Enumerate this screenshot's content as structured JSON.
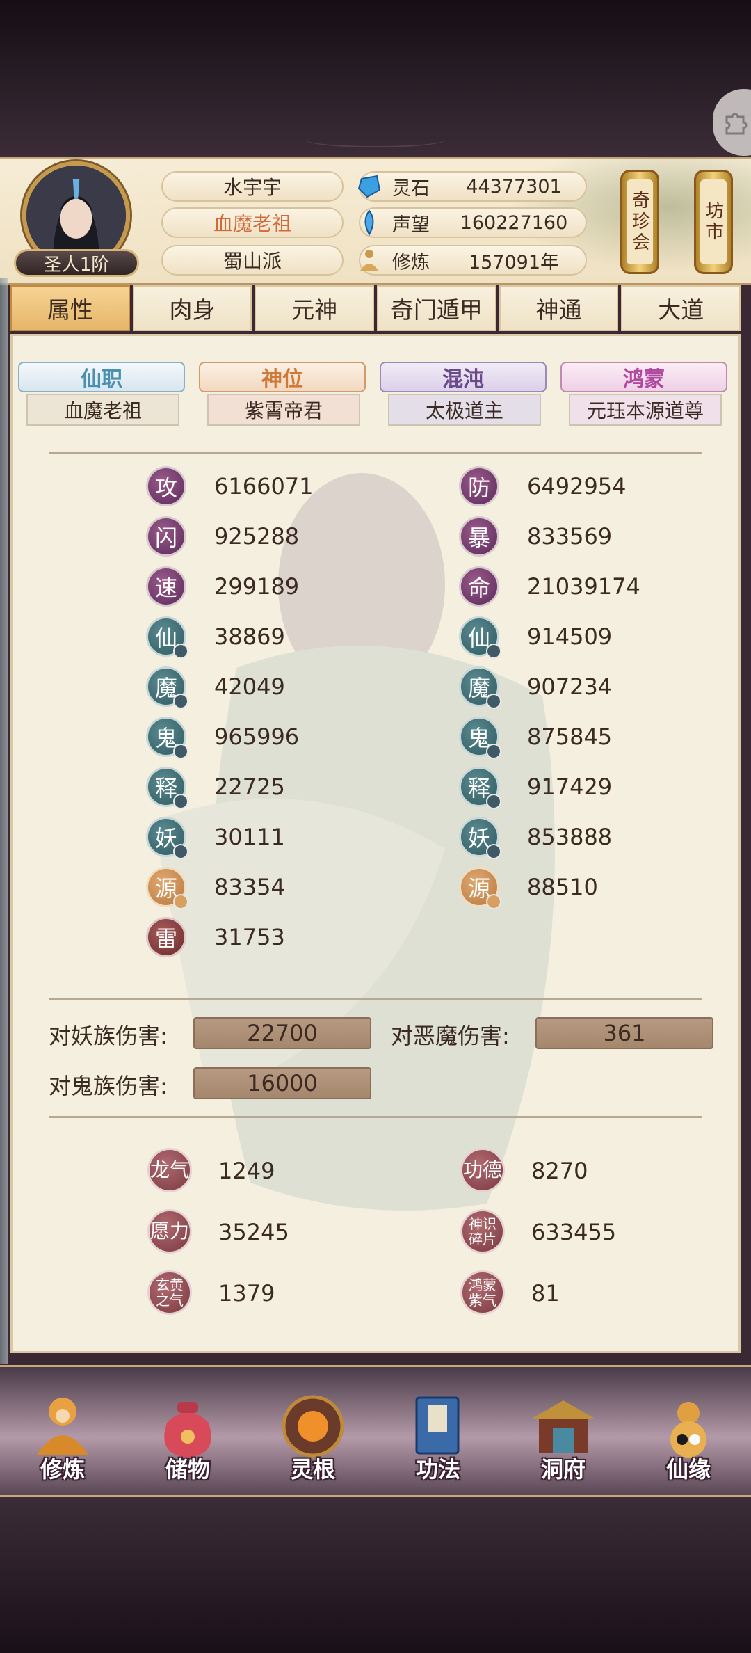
{
  "player": {
    "name": "水宇宇",
    "title": "血魔老祖",
    "sect": "蜀山派",
    "rank": "圣人1阶"
  },
  "resources": [
    {
      "label": "灵石",
      "value": "44377301",
      "icon": "spirit-stone-icon"
    },
    {
      "label": "声望",
      "value": "160227160",
      "icon": "prestige-icon"
    },
    {
      "label": "修炼",
      "value": "157091年",
      "icon": "cultivation-icon"
    }
  ],
  "side_buttons": [
    {
      "label": "奇珍会"
    },
    {
      "label": "坊市"
    }
  ],
  "tabs": [
    "属性",
    "肉身",
    "元神",
    "奇门遁甲",
    "神通",
    "大道"
  ],
  "active_tab": "属性",
  "titles": [
    {
      "tag": "仙职",
      "value": "血魔老祖",
      "color": "#4a8fb0"
    },
    {
      "tag": "神位",
      "value": "紫霄帝君",
      "color": "#d07a3a"
    },
    {
      "tag": "混沌",
      "value": "太极道主",
      "color": "#6a4a8a"
    },
    {
      "tag": "鸿蒙",
      "value": "元珏本源道尊",
      "color": "#b04aa0"
    }
  ],
  "stats_left": [
    {
      "glyph": "攻",
      "value": "6166071",
      "style": "purple"
    },
    {
      "glyph": "闪",
      "value": "925288",
      "style": "purple"
    },
    {
      "glyph": "速",
      "value": "299189",
      "style": "purple"
    },
    {
      "glyph": "仙",
      "value": "38869",
      "style": "teal"
    },
    {
      "glyph": "魔",
      "value": "42049",
      "style": "teal"
    },
    {
      "glyph": "鬼",
      "value": "965996",
      "style": "teal"
    },
    {
      "glyph": "释",
      "value": "22725",
      "style": "teal"
    },
    {
      "glyph": "妖",
      "value": "30111",
      "style": "teal"
    },
    {
      "glyph": "源",
      "value": "83354",
      "style": "amber"
    },
    {
      "glyph": "雷",
      "value": "31753",
      "style": "red"
    }
  ],
  "stats_right": [
    {
      "glyph": "防",
      "value": "6492954",
      "style": "purple"
    },
    {
      "glyph": "暴",
      "value": "833569",
      "style": "purple"
    },
    {
      "glyph": "命",
      "value": "21039174",
      "style": "purple"
    },
    {
      "glyph": "仙",
      "value": "914509",
      "style": "teal"
    },
    {
      "glyph": "魔",
      "value": "907234",
      "style": "teal"
    },
    {
      "glyph": "鬼",
      "value": "875845",
      "style": "teal"
    },
    {
      "glyph": "释",
      "value": "917429",
      "style": "teal"
    },
    {
      "glyph": "妖",
      "value": "853888",
      "style": "teal"
    },
    {
      "glyph": "源",
      "value": "88510",
      "style": "amber"
    }
  ],
  "damage": [
    {
      "label": "对妖族伤害:",
      "value": "22700"
    },
    {
      "label": "对恶魔伤害:",
      "value": "361"
    },
    {
      "label": "对鬼族伤害:",
      "value": "16000"
    }
  ],
  "extra_resources": [
    {
      "glyph": "龙气",
      "value": "1249"
    },
    {
      "glyph": "功德",
      "value": "8270"
    },
    {
      "glyph": "愿力",
      "value": "35245"
    },
    {
      "glyph": "神识碎片",
      "value": "633455"
    },
    {
      "glyph": "玄黄之气",
      "value": "1379"
    },
    {
      "glyph": "鸿蒙紫气",
      "value": "81"
    }
  ],
  "nav": [
    {
      "label": "修炼",
      "icon": "meditating-figure-icon"
    },
    {
      "label": "储物",
      "icon": "treasure-bag-icon"
    },
    {
      "label": "灵根",
      "icon": "spirit-root-icon"
    },
    {
      "label": "功法",
      "icon": "book-icon"
    },
    {
      "label": "洞府",
      "icon": "cave-mansion-icon"
    },
    {
      "label": "仙缘",
      "icon": "gourd-icon"
    }
  ]
}
